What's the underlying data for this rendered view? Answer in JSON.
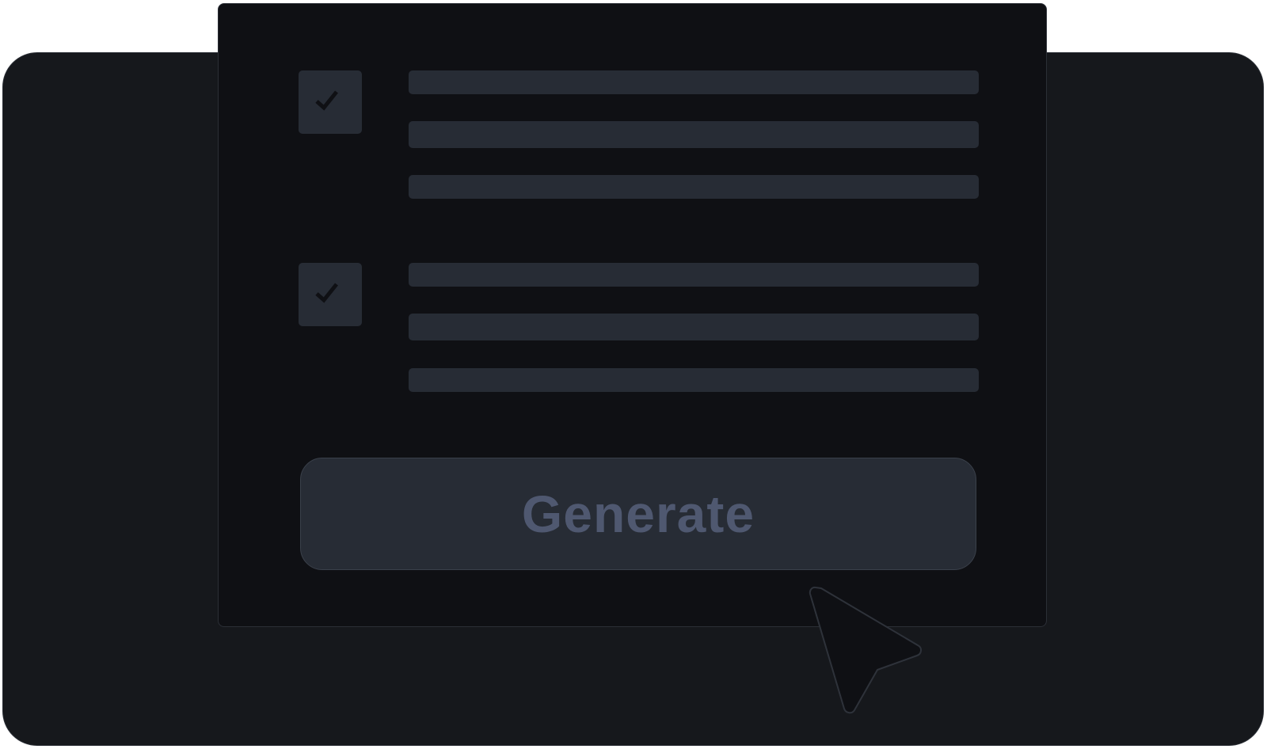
{
  "colors": {
    "backdrop": "#16181c",
    "panel": "#0f1014",
    "placeholder": "#272c35",
    "button_text": "#4f5870",
    "checkmark": "#0f1014"
  },
  "checklist": [
    {
      "checked": true,
      "icon": "checkmark-icon"
    },
    {
      "checked": true,
      "icon": "checkmark-icon"
    }
  ],
  "actions": {
    "generate_label": "Generate"
  },
  "pointer": {
    "icon": "cursor-arrow-icon"
  }
}
